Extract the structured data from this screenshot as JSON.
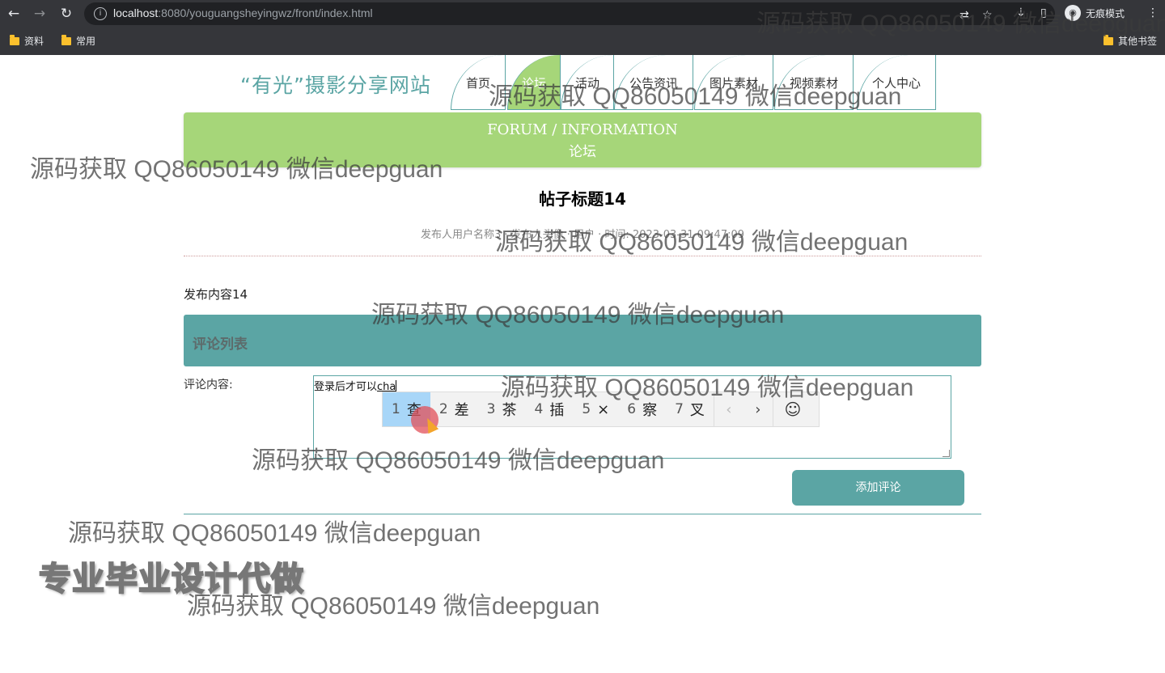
{
  "browser": {
    "url_host": "localhost",
    "url_rest": ":8080/youguangsheyingwz/front/index.html",
    "incognito_label": "无痕模式",
    "bookmarks": [
      "资料",
      "常用"
    ],
    "other_bookmarks": "其他书签"
  },
  "site": {
    "title": "“有光”摄影分享网站",
    "nav": [
      "首页",
      "论坛",
      "活动",
      "公告资讯",
      "图片素材",
      "视频素材",
      "个人中心"
    ],
    "active_nav": "论坛"
  },
  "banner": {
    "en": "FORUM / INFORMATION",
    "cn": "论坛"
  },
  "post": {
    "title": "帖子标题14",
    "meta": "发布人用户名称3 · 发布人头像 · 用户 · 时间: 2023-03-31 09:47:09",
    "content": "发布内容14"
  },
  "comments": {
    "header": "评论列表",
    "label": "评论内容:",
    "text_prefix": "登录后才可以",
    "text_typing": "cha",
    "submit": "添加评论"
  },
  "ime": {
    "candidates": [
      {
        "n": "1",
        "c": "查"
      },
      {
        "n": "2",
        "c": "差"
      },
      {
        "n": "3",
        "c": "茶"
      },
      {
        "n": "4",
        "c": "插"
      },
      {
        "n": "5",
        "c": "×"
      },
      {
        "n": "6",
        "c": "察"
      },
      {
        "n": "7",
        "c": "叉"
      }
    ],
    "prev": "‹",
    "next": "›",
    "emoji": "☺"
  },
  "overlay": {
    "watermark": "源码获取 QQ86050149 微信deepguan",
    "promo": "专业毕业设计代做"
  }
}
